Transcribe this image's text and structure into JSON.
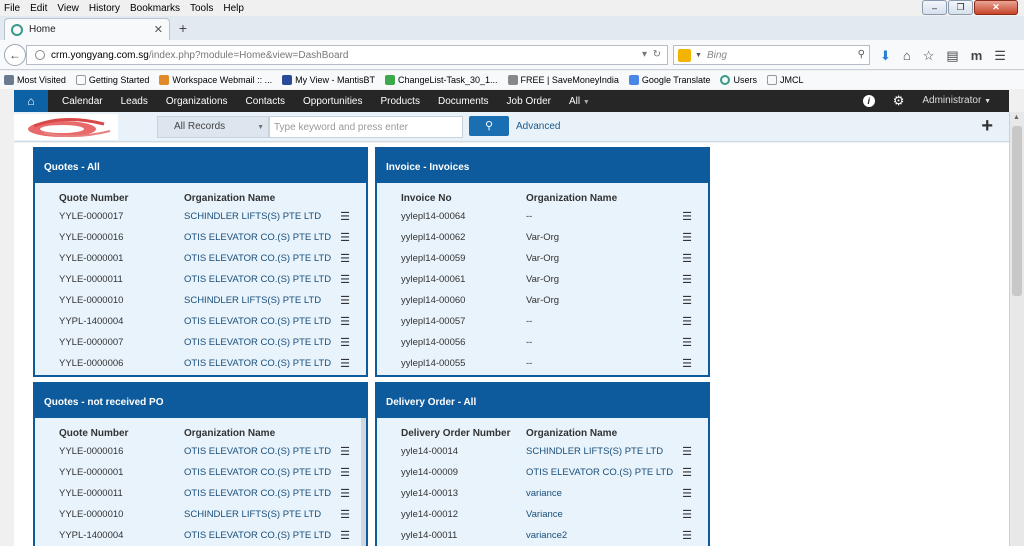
{
  "browser": {
    "menu": [
      "File",
      "Edit",
      "View",
      "History",
      "Bookmarks",
      "Tools",
      "Help"
    ],
    "tab_title": "Home",
    "url_host": "crm.yongyang.com.sg",
    "url_path": "/index.php?module=Home&view=DashBoard",
    "search_placeholder": "Bing",
    "bookmarks": [
      "Most Visited",
      "Getting Started",
      "Workspace Webmail :: ...",
      "My View - MantisBT",
      "ChangeList-Task_30_1...",
      "FREE | SaveMoneyIndia",
      "Google Translate",
      "Users",
      "JMCL"
    ]
  },
  "crm": {
    "nav": [
      "Calendar",
      "Leads",
      "Organizations",
      "Contacts",
      "Opportunities",
      "Products",
      "Documents",
      "Job Order",
      "All"
    ],
    "user": "Administrator",
    "records_select": "All Records",
    "keyword_placeholder": "Type keyword and press enter",
    "advanced": "Advanced"
  },
  "widgets": [
    {
      "title": "Quotes - All",
      "col1": "Quote Number",
      "col2": "Organization Name",
      "rows": [
        [
          "YYLE-0000017",
          "SCHINDLER LIFTS(S) PTE LTD"
        ],
        [
          "YYLE-0000016",
          "OTIS ELEVATOR CO.(S) PTE LTD"
        ],
        [
          "YYLE-0000001",
          "OTIS ELEVATOR CO.(S) PTE LTD"
        ],
        [
          "YYLE-0000011",
          "OTIS ELEVATOR CO.(S) PTE LTD"
        ],
        [
          "YYLE-0000010",
          "SCHINDLER LIFTS(S) PTE LTD"
        ],
        [
          "YYPL-1400004",
          "OTIS ELEVATOR CO.(S) PTE LTD"
        ],
        [
          "YYLE-0000007",
          "OTIS ELEVATOR CO.(S) PTE LTD"
        ],
        [
          "YYLE-0000006",
          "OTIS ELEVATOR CO.(S) PTE LTD"
        ]
      ]
    },
    {
      "title": "Invoice - Invoices",
      "col1": "Invoice No",
      "col2": "Organization Name",
      "rows": [
        [
          "yylepl14-00064",
          "--"
        ],
        [
          "yylepl14-00062",
          "Var-Org"
        ],
        [
          "yylepl14-00059",
          "Var-Org"
        ],
        [
          "yylepl14-00061",
          "Var-Org"
        ],
        [
          "yylepl14-00060",
          "Var-Org"
        ],
        [
          "yylepl14-00057",
          "--"
        ],
        [
          "yylepl14-00056",
          "--"
        ],
        [
          "yylepl14-00055",
          "--"
        ]
      ]
    },
    {
      "title": "Quotes - not received PO",
      "col1": "Quote Number",
      "col2": "Organization Name",
      "rows": [
        [
          "YYLE-0000016",
          "OTIS ELEVATOR CO.(S) PTE LTD"
        ],
        [
          "YYLE-0000001",
          "OTIS ELEVATOR CO.(S) PTE LTD"
        ],
        [
          "YYLE-0000011",
          "OTIS ELEVATOR CO.(S) PTE LTD"
        ],
        [
          "YYLE-0000010",
          "SCHINDLER LIFTS(S) PTE LTD"
        ],
        [
          "YYPL-1400004",
          "OTIS ELEVATOR CO.(S) PTE LTD"
        ]
      ]
    },
    {
      "title": "Delivery Order - All",
      "col1": "Delivery Order Number",
      "col2": "Organization Name",
      "rows": [
        [
          "yyle14-00014",
          "SCHINDLER LIFTS(S) PTE LTD"
        ],
        [
          "yyle14-00009",
          "OTIS ELEVATOR CO.(S) PTE LTD"
        ],
        [
          "yyle14-00013",
          "variance"
        ],
        [
          "yyle14-00012",
          "Variance"
        ],
        [
          "yyle14-00011",
          "variance2"
        ]
      ]
    }
  ]
}
